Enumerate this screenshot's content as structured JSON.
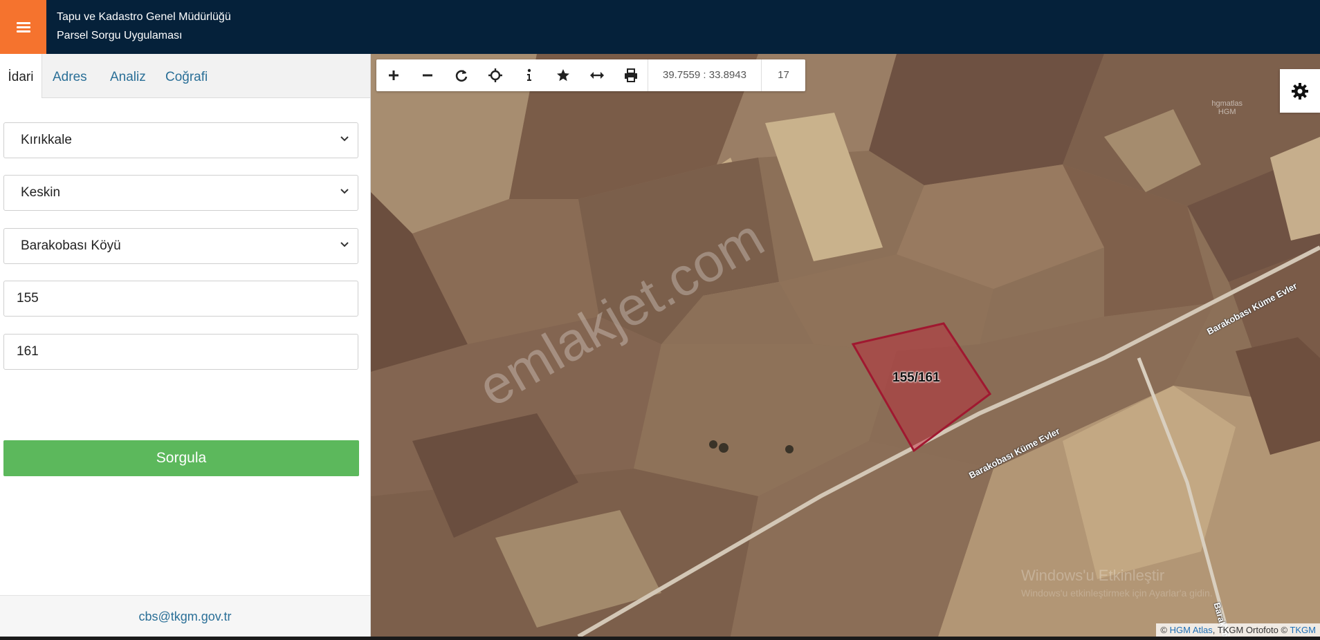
{
  "header": {
    "menu_icon": "hamburger-icon",
    "title_line1": "Tapu ve Kadastro Genel Müdürlüğü",
    "title_line2": "Parsel Sorgu Uygulaması",
    "brand_color": "#05213a",
    "accent_color": "#f5732e"
  },
  "sidebar": {
    "tabs": [
      {
        "label": "İdari",
        "active": true
      },
      {
        "label": "Adres",
        "active": false
      },
      {
        "label": "Analiz",
        "active": false
      },
      {
        "label": "Coğrafi",
        "active": false
      }
    ],
    "il": "Kırıkkale",
    "ilce": "Keskin",
    "mahalle": "Barakobası Köyü",
    "ada": "155",
    "parsel": "161",
    "submit_label": "Sorgula",
    "submit_color": "#5cb85c",
    "footer_email": "cbs@tkgm.gov.tr"
  },
  "map": {
    "toolbar_icons": [
      "zoom-in-icon",
      "zoom-out-icon",
      "refresh-icon",
      "locate-icon",
      "info-icon",
      "star-icon",
      "measure-icon",
      "print-icon"
    ],
    "coordinates": "39.7559 : 33.8943",
    "zoom_level": "17",
    "parcel_label": "155/161",
    "road_label_1": "Barakobası Küme Evler",
    "road_label_2": "Barakobası Küme Evler",
    "road_label_3": "Barakobası Kü",
    "hg_label_1": "hgmatlas",
    "hg_label_2": "HGM",
    "watermark": "emlakjet.com",
    "windows_activation": "Windows'u Etkinleştir",
    "windows_activation_sub": "Windows'u etkinleştirmek için Ayarlar'a gidin.",
    "attribution_prefix": "©",
    "attribution_link1": "HGM Atlas",
    "attribution_mid": ", TKGM Ortofoto ©",
    "attribution_link2": "TKGM"
  }
}
